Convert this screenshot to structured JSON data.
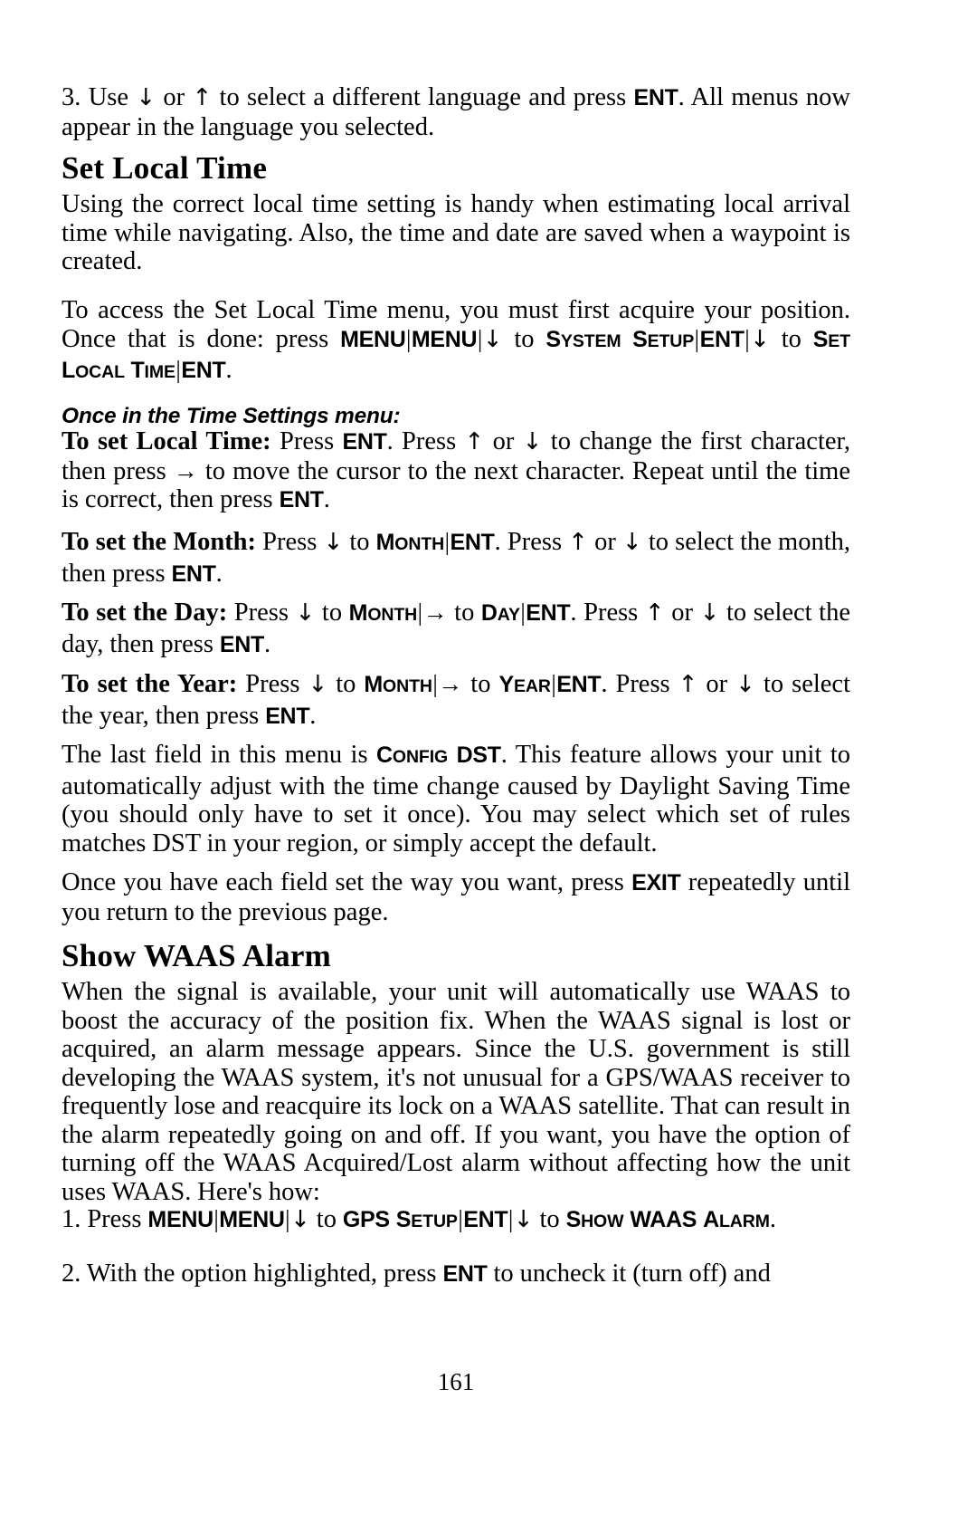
{
  "document": {
    "type": "printed-manual-page",
    "page_number": "161",
    "background_color": "#ffffff",
    "text_color": "#000000"
  },
  "blocks": {
    "step3": {
      "number": "3. ",
      "t1": "Use ",
      "arrow_down": "↓",
      "t2": " or ",
      "arrow_up": "↑",
      "t3": " to select a different language and press ",
      "key_ent": "ENT",
      "t4": ". All menus now appear in the language you selected."
    },
    "heading_set_local_time": "Set Local Time",
    "p1": "Using the correct local time setting is handy when estimating local arrival time while navigating. Also, the time and date are saved when a waypoint is created.",
    "p2": {
      "t1": "To access the Set Local Time menu, you must first acquire your position. Once that is done: press ",
      "key_menu_1": "MENU",
      "sep1": "|",
      "key_menu_2": "MENU",
      "sep2": "|",
      "arrow_down": "↓",
      "t2": " to ",
      "sc_system_setup_big1": "S",
      "sc_system_setup_small1": "YSTEM",
      "sc_system_setup_big2": "S",
      "sc_system_setup_small2": "ETUP",
      "sep3": "|",
      "key_ent_1": "ENT",
      "sep4": "|",
      "arrow_down2": "↓",
      "t3": " to ",
      "sc_set_big": "S",
      "sc_set_small": "ET",
      "sc_local_big": "L",
      "sc_local_small": "OCAL",
      "sc_time_big": "T",
      "sc_time_small": "IME",
      "sep5": "|",
      "key_ent_2": "ENT",
      "t4": "."
    },
    "subhead_once_in_time_settings": "Once in the Time Settings menu:",
    "p3": {
      "lead": "To set Local Time:",
      "t1": " Press ",
      "key_ent_1": "ENT",
      "t2": ". Press ",
      "arrow_up": "↑",
      "t3": " or ",
      "arrow_down": "↓",
      "t4": " to change the first character, then press ",
      "arrow_right": "→",
      "t5": " to move the cursor to the next character. Repeat until the time is correct, then press ",
      "key_ent_2": "ENT",
      "t6": "."
    },
    "p4": {
      "lead": "To set the Month:",
      "t1": " Press ",
      "arrow_down1": "↓",
      "t2": " to ",
      "sc_month_big": "M",
      "sc_month_small": "ONTH",
      "sep1": "|",
      "key_ent_1": "ENT",
      "t3": ". Press ",
      "arrow_up": "↑",
      "t4": " or ",
      "arrow_down2": "↓",
      "t5": " to select the month, then press ",
      "key_ent_2": "ENT",
      "t6": "."
    },
    "p5": {
      "lead": "To set the Day:",
      "t1": " Press ",
      "arrow_down1": "↓",
      "t2": " to ",
      "sc_month_big": "M",
      "sc_month_small": "ONTH",
      "sep1": "|",
      "arrow_right": "→",
      "t3": " to ",
      "sc_day_big": "D",
      "sc_day_small": "AY",
      "sep2": "|",
      "key_ent_1": "ENT",
      "t4": ". Press ",
      "arrow_up": "↑",
      "t5": " or ",
      "arrow_down2": "↓",
      "t6": " to select the day, then press ",
      "key_ent_2": "ENT",
      "t7": "."
    },
    "p6": {
      "lead": "To set the Year:",
      "t1": " Press ",
      "arrow_down1": "↓",
      "t2": " to ",
      "sc_month_big": "M",
      "sc_month_small": "ONTH",
      "sep1": "|",
      "arrow_right": "→",
      "t3": " to ",
      "sc_year_big": "Y",
      "sc_year_small": "EAR",
      "sep2": "|",
      "key_ent_1": "ENT",
      "t4": ". Press ",
      "arrow_up": "↑",
      "t5": " or ",
      "arrow_down2": "↓",
      "t6": " to select the year, then press ",
      "key_ent_2": "ENT",
      "t7": "."
    },
    "p7": {
      "t1": "The last field in this menu is ",
      "sc_config_big": "C",
      "sc_config_small": "ONFIG",
      "key_dst": "DST",
      "t2": ". This feature allows your unit to automatically adjust with the time change caused by Daylight Saving Time (you should only have to set it once). You may select which set of rules matches DST in your region, or simply accept the default."
    },
    "p8": {
      "t1": "Once you have each field set the way you want, press ",
      "key_exit": "EXIT",
      "t2": " repeatedly until you return to the previous page."
    },
    "heading_show_waas_alarm": "Show WAAS Alarm",
    "p9": "When the signal is available, your unit will automatically use WAAS to boost the accuracy of the position fix. When the WAAS signal is lost or acquired, an alarm message appears. Since the U.S. government is still developing the WAAS system, it's not unusual for a GPS/WAAS receiver to frequently lose and reacquire its lock on a WAAS satellite. That can result in the alarm repeatedly going on and off. If you want, you have the option of turning off the WAAS Acquired/Lost alarm without affecting how the unit uses WAAS. Here's how:",
    "p10": {
      "number": "1. ",
      "t1": "Press ",
      "key_menu_1": "MENU",
      "sep1": "|",
      "key_menu_2": "MENU",
      "sep2": "|",
      "arrow_down1": "↓",
      "t2": " to ",
      "key_gps": "GPS",
      "t3": " ",
      "sc_setup_big": "S",
      "sc_setup_small": "ETUP",
      "sep3": "|",
      "key_ent": "ENT",
      "sep4": "|",
      "arrow_down2": "↓",
      "t4": " to ",
      "sc_show_big": "S",
      "sc_show_small": "HOW",
      "key_waas": "WAAS",
      "sc_alarm_big": "A",
      "sc_alarm_small": "LARM",
      "t5": "."
    },
    "p11": {
      "number": "2. ",
      "t1": "With the option highlighted, press ",
      "key_ent": "ENT",
      "t2": " to uncheck it (turn off) and"
    }
  }
}
